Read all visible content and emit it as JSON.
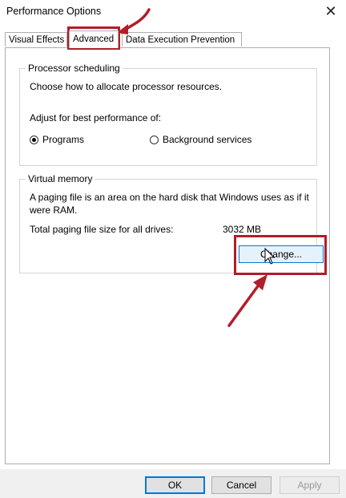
{
  "window": {
    "title": "Performance Options",
    "close_glyph": "✕"
  },
  "tabs": [
    {
      "label": "Visual Effects"
    },
    {
      "label": "Advanced"
    },
    {
      "label": "Data Execution Prevention"
    }
  ],
  "processor_scheduling": {
    "group_title": "Processor scheduling",
    "description": "Choose how to allocate processor resources.",
    "adjust_label": "Adjust for best performance of:",
    "options": [
      {
        "label": "Programs",
        "selected": true
      },
      {
        "label": "Background services",
        "selected": false
      }
    ]
  },
  "virtual_memory": {
    "group_title": "Virtual memory",
    "description_line1": "A paging file is an area on the hard disk that Windows uses as if it",
    "description_line2": "were RAM.",
    "total_label": "Total paging file size for all drives:",
    "total_value": "3032 MB",
    "change_button": "Change..."
  },
  "footer": {
    "ok": "OK",
    "cancel": "Cancel",
    "apply": "Apply"
  },
  "colors": {
    "annotation": "#b01e2a",
    "accent": "#0078d7"
  },
  "icons": {
    "close": "close-icon",
    "cursor": "mouse-pointer-icon",
    "annotation_arrow": "red-arrow-icon"
  }
}
